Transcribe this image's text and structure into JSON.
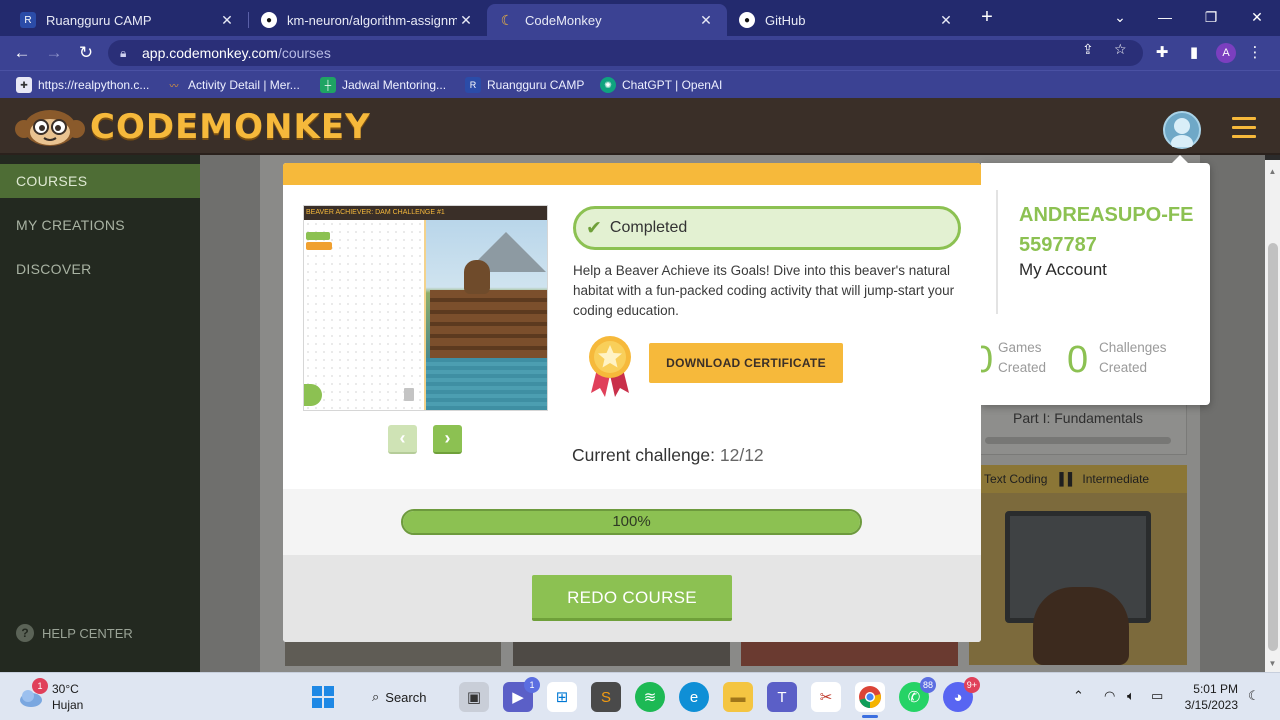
{
  "browser": {
    "tabs": [
      {
        "label": "Ruangguru CAMP",
        "icon": "ruangguru-icon",
        "color": "#2b4ca8"
      },
      {
        "label": "km-neuron/algorithm-assignmen",
        "icon": "github-icon",
        "color": "#111111"
      },
      {
        "label": "CodeMonkey",
        "icon": "banana-icon",
        "color": "#f6b93b"
      },
      {
        "label": "GitHub",
        "icon": "github-icon",
        "color": "#111111"
      }
    ],
    "close_glyph": "✕",
    "new_tab_glyph": "+",
    "url_domain": "app.codemonkey.com",
    "url_path": "/courses",
    "profile_initial": "A",
    "bookmarks": [
      {
        "label": "https://realpython.c...",
        "icon": "realpython-icon"
      },
      {
        "label": "Activity Detail | Mer...",
        "icon": "activity-icon"
      },
      {
        "label": "Jadwal Mentoring...",
        "icon": "sheets-icon"
      },
      {
        "label": "Ruangguru CAMP",
        "icon": "ruangguru-icon"
      },
      {
        "label": "ChatGPT | OpenAI",
        "icon": "openai-icon"
      }
    ]
  },
  "site": {
    "brand": "CODEMONKEY",
    "colors": {
      "accent": "#8cc152",
      "brand_yellow": "#f6b93b",
      "header": "#3a2f28"
    }
  },
  "sidebar": {
    "items": [
      {
        "label": "COURSES",
        "active": true
      },
      {
        "label": "MY CREATIONS",
        "active": false
      },
      {
        "label": "DISCOVER",
        "active": false
      }
    ],
    "help": "HELP CENTER"
  },
  "background": {
    "course_label": "Part I: Fundamentals",
    "tags": [
      "Text Coding",
      "Intermediate"
    ]
  },
  "account": {
    "username": "ANDREASUPO-FE5597787",
    "my_account": "My Account",
    "stats": [
      {
        "value": "0",
        "label": "Games Created"
      },
      {
        "value": "0",
        "label": "Challenges Created"
      }
    ]
  },
  "modal": {
    "preview_title": "BEAVER ACHIEVER: DAM CHALLENGE #1",
    "status": "Completed",
    "description": "Help a Beaver Achieve its Goals! Dive into this beaver's natural habitat with a fun-packed coding activity that will jump-start your coding education.",
    "download_label": "DOWNLOAD CERTIFICATE",
    "current_label": "Current challenge:",
    "current_value": "12/12",
    "progress_percent": 100,
    "progress_label": "100%",
    "redo_label": "REDO COURSE"
  },
  "taskbar": {
    "temperature": "30°C",
    "weather": "Hujan",
    "weather_badge": "1",
    "search_label": "Search",
    "apps": [
      {
        "name": "file-explorer-icon"
      },
      {
        "name": "teams-chat-icon",
        "badge": "1"
      },
      {
        "name": "microsoft-store-icon"
      },
      {
        "name": "sublime-text-icon"
      },
      {
        "name": "spotify-icon"
      },
      {
        "name": "edge-icon"
      },
      {
        "name": "folder-icon"
      },
      {
        "name": "teams-icon"
      },
      {
        "name": "snipping-tool-icon"
      },
      {
        "name": "chrome-icon"
      },
      {
        "name": "whatsapp-icon",
        "badge": "88"
      },
      {
        "name": "discord-icon",
        "badge": "9+"
      }
    ],
    "time": "5:01 PM",
    "date": "3/15/2023"
  }
}
